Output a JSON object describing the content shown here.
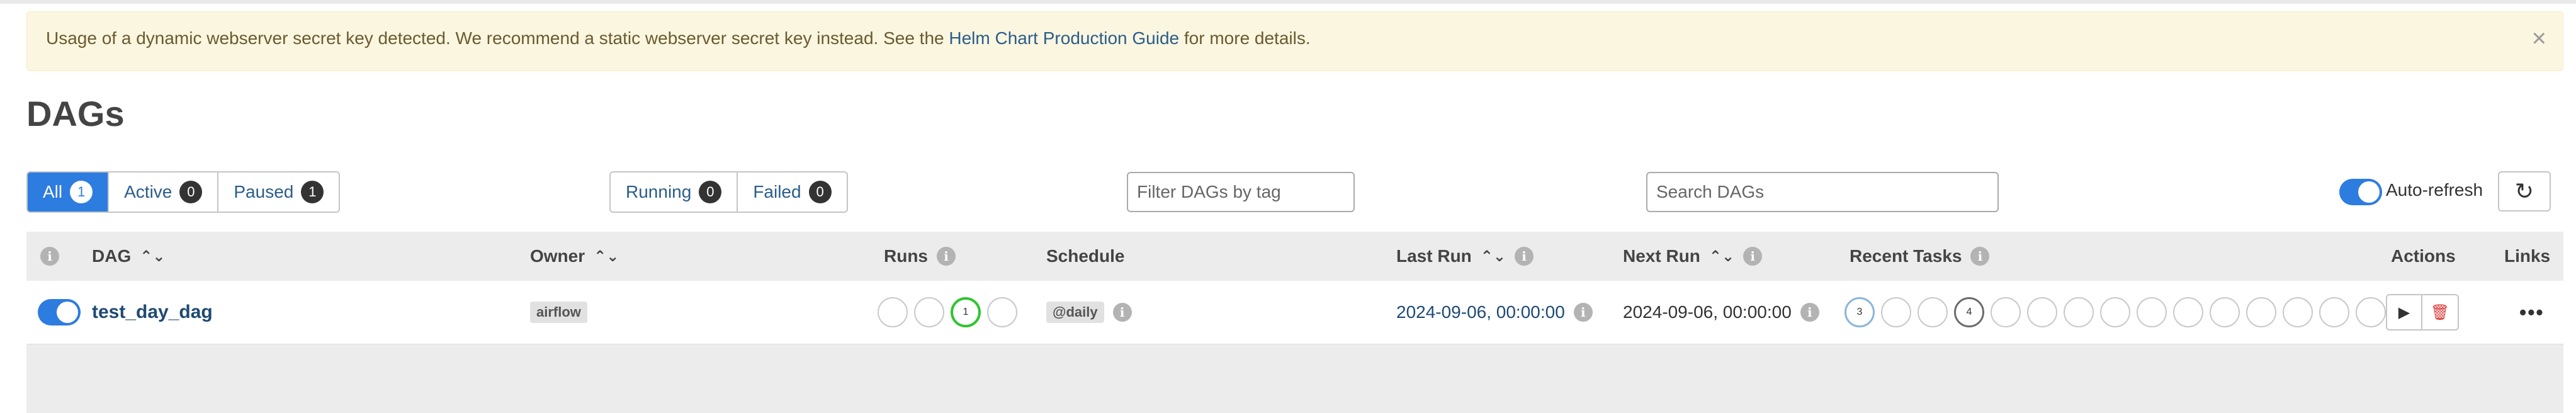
{
  "alert": {
    "text_before": "Usage of a dynamic webserver secret key detected. We recommend a static webserver secret key instead. See the ",
    "link_text": "Helm Chart Production Guide",
    "text_after": " for more details.",
    "close": "×"
  },
  "page_title": "DAGs",
  "status_filter": [
    {
      "label": "All",
      "count": "1"
    },
    {
      "label": "Active",
      "count": "0"
    },
    {
      "label": "Paused",
      "count": "1"
    }
  ],
  "run_filter": [
    {
      "label": "Running",
      "count": "0"
    },
    {
      "label": "Failed",
      "count": "0"
    }
  ],
  "tag_filter": {
    "placeholder": "Filter DAGs by tag"
  },
  "search": {
    "placeholder": "Search DAGs"
  },
  "auto_refresh": {
    "label": "Auto-refresh",
    "enabled": true
  },
  "refresh_icon": "↻",
  "columns": {
    "dag": "DAG",
    "owner": "Owner",
    "runs": "Runs",
    "schedule": "Schedule",
    "last_run": "Last Run",
    "next_run": "Next Run",
    "recent_tasks": "Recent Tasks",
    "actions": "Actions",
    "links": "Links"
  },
  "dags": [
    {
      "active": true,
      "dag_id": "test_day_dag",
      "owner": "airflow",
      "runs": [
        "",
        "",
        "1",
        ""
      ],
      "schedule": "@daily",
      "last_run": "2024-09-06, 00:00:00",
      "next_run": "2024-09-06, 00:00:00",
      "recent_tasks": [
        "3",
        "",
        "",
        "4",
        "",
        "",
        "",
        "",
        "",
        "",
        "",
        "",
        "",
        "",
        ""
      ],
      "links_icon": "•••"
    }
  ],
  "icons": {
    "info": "i",
    "sort": "⌃⌄",
    "play": "▶",
    "delete": "🗑"
  },
  "colors": {
    "primary": "#2d7ce0",
    "link": "#1e4a75",
    "running": "#2ec52e",
    "queued": "#8bb5d8",
    "alert_bg": "#fbf6e0"
  }
}
